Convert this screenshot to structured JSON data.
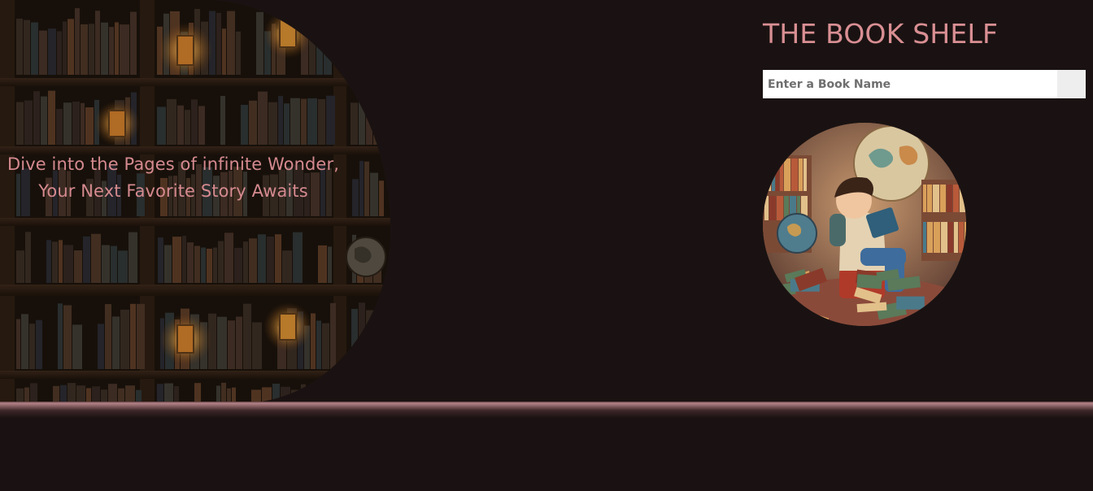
{
  "hero": {
    "line1": "Dive into the Pages of infinite Wonder,",
    "line2": "Your Next Favorite Story Awaits",
    "image_icon": "bookshelf-illustration"
  },
  "header": {
    "title": "THE BOOK SHELF"
  },
  "search": {
    "placeholder": "Enter a Book Name",
    "value": "",
    "button_icon": "search-icon"
  },
  "illustration": {
    "icon": "boy-reading-illustration"
  },
  "colors": {
    "background": "#1a1212",
    "accent": "#d98f93",
    "shelf_bar": "#b48489"
  }
}
